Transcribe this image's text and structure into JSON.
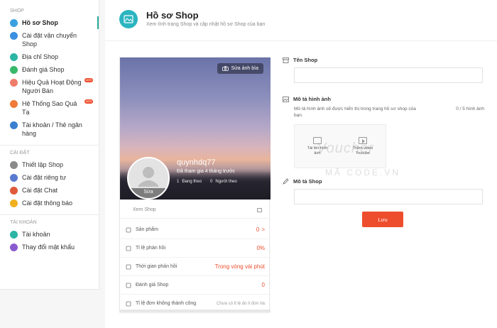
{
  "sidebar": {
    "shop_section": "SHOP",
    "shop_items": [
      {
        "label": "Hồ sơ Shop",
        "icon": "profile-icon",
        "color": "#3aa0e0"
      },
      {
        "label": "Cài đặt vận chuyển Shop",
        "icon": "truck-icon",
        "color": "#3a8fe0"
      },
      {
        "label": "Địa chỉ Shop",
        "icon": "location-icon",
        "color": "#2bb5a5"
      },
      {
        "label": "Đánh giá Shop",
        "icon": "star-icon",
        "color": "#38b86a"
      },
      {
        "label": "Hiệu Quả Hoạt Động Người Bán",
        "icon": "performance-icon",
        "color": "#f07c6a",
        "badge": "MỚI"
      },
      {
        "label": "Hệ Thống Sao Quả Tạ",
        "icon": "lightning-icon",
        "color": "#f07a3a",
        "badge": "MỚI"
      },
      {
        "label": "Tài khoản / Thẻ ngân hàng",
        "icon": "bank-card-icon",
        "color": "#3a7fd0"
      }
    ],
    "settings_section": "CÀI ĐẶT",
    "settings_items": [
      {
        "label": "Thiết lập Shop",
        "icon": "gear-icon",
        "color": "#8a8a8a"
      },
      {
        "label": "Cài đặt riêng tư",
        "icon": "lock-icon",
        "color": "#5a7ad0"
      },
      {
        "label": "Cài đặt Chat",
        "icon": "chat-icon",
        "color": "#e05a3a"
      },
      {
        "label": "Cài đặt thông báo",
        "icon": "bell-icon",
        "color": "#f0b020"
      }
    ],
    "account_section": "TÀI KHOẢN",
    "account_items": [
      {
        "label": "Tài khoản",
        "icon": "account-icon",
        "color": "#2bb5a5"
      },
      {
        "label": "Thay đổi mật khẩu",
        "icon": "key-icon",
        "color": "#8a5ad0"
      }
    ]
  },
  "header": {
    "title": "Hồ sơ Shop",
    "subtitle": "Xem tình trạng Shop và cập nhật hồ sơ Shop của bạn",
    "icon_color": "#2bb5c0"
  },
  "profile": {
    "edit_cover": "Sửa ảnh bìa",
    "avatar_edit": "Sửa",
    "shop_name": "quynhdq77",
    "joined": "Đã tham gia 4 tháng trước",
    "following_count": "1",
    "following_label": "Đang theo",
    "followers_count": "0",
    "followers_label": "Người theo",
    "view_shop": "Xem Shop",
    "stats": [
      {
        "label": "Sản phẩm",
        "value": "0",
        "icon": "box-icon",
        "arrow": ">"
      },
      {
        "label": "Tỉ lệ phản hồi",
        "value": "0%",
        "icon": "chat-bubble-icon"
      },
      {
        "label": "Thời gian phản hồi",
        "value": "Trong vòng vài phút",
        "icon": "clock-icon"
      },
      {
        "label": "Đánh giá Shop",
        "value": "0",
        "icon": "star-outline-icon"
      },
      {
        "label": "Tỉ lệ đơn không thành công",
        "value": "Chưa có tỉ lệ do ít đơn hà",
        "icon": "clipboard-icon"
      }
    ]
  },
  "form": {
    "shop_name_label": "Tên Shop",
    "shop_name_value": "",
    "image_desc_label": "Mô tả hình ảnh",
    "image_desc_help": "Mô tả hình ảnh sẽ được hiển thị trong trang hồ sơ shop của bạn.",
    "image_count": "0 / 5 hình ảnh",
    "add_image_label": "Tải lên hình ảnh",
    "add_video_label": "Thêm video Youtube",
    "description_label": "Mô tả Shop",
    "description_value": "",
    "save_label": "Lưu"
  },
  "watermark": {
    "line1": "Voucher",
    "line2": "MÃ CODE.VN"
  },
  "colors": {
    "accent": "#ee4d2d",
    "teal": "#26aa99"
  }
}
